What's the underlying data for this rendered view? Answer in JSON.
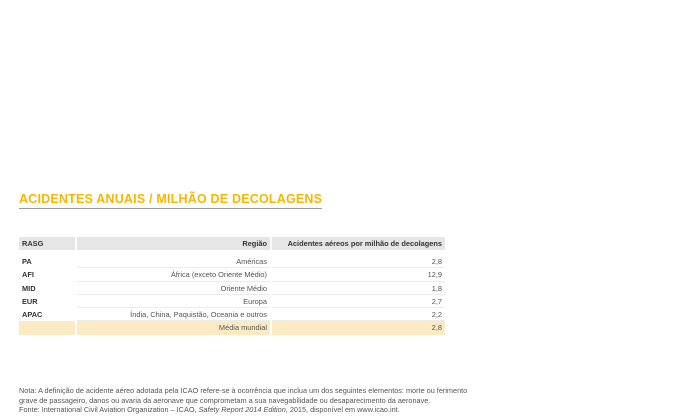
{
  "title": "ACIDENTES ANUAIS / MILHÃO DE DECOLAGENS",
  "table": {
    "headers": {
      "code": "RASG",
      "region": "Região",
      "value": "Acidentes aéreos por milhão de decolagens"
    },
    "rows": [
      {
        "code": "PA",
        "region": "Américas",
        "value": "2,8"
      },
      {
        "code": "AFI",
        "region": "África (exceto Oriente Médio)",
        "value": "12,9"
      },
      {
        "code": "MID",
        "region": "Oriente Médio",
        "value": "1,8"
      },
      {
        "code": "EUR",
        "region": "Europa",
        "value": "2,7"
      },
      {
        "code": "APAC",
        "region": "Índia, China, Paquistão, Oceania e outros",
        "value": "2,2"
      },
      {
        "code": "",
        "region": "Média mundial",
        "value": "2,8"
      }
    ],
    "highlight_color": "#fcebc2"
  },
  "footer": {
    "note_line1": "Nota: A definição de acidente aéreo adotada pela ICAO refere-se à ocorrência que inclua um dos seguintes elementos: morte ou ferimento",
    "note_line2": "grave de passageiro, danos ou avaria da aeronave que comprometam a sua navegabilidade ou desaparecimento da aeronave.",
    "source_prefix": "Fonte: International Civil Aviation Organization – ICAO, ",
    "source_title": "Safety Report 2014 Edition",
    "source_suffix": ", 2015, disponível em www.icao.int."
  },
  "colors": {
    "title": "#f5b800",
    "header_bg": "#e6e6e6"
  }
}
